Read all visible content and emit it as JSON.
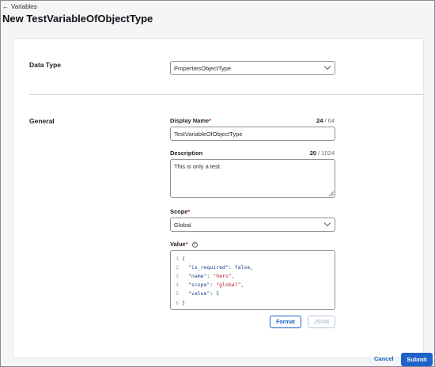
{
  "breadcrumb": {
    "arrow": "←",
    "label": "Variables"
  },
  "page_title": "New TestVariableOfObjectType",
  "sections": {
    "data_type": {
      "label": "Data Type",
      "selected": "PropertiesObjectType"
    },
    "general": {
      "label": "General"
    }
  },
  "fields": {
    "display_name": {
      "label": "Display Name",
      "required": "*",
      "value": "TestVariableOfObjectType",
      "count": "24",
      "max": "/ 64"
    },
    "description": {
      "label": "Description",
      "value": "This is only a test.",
      "count": "20",
      "max": "/ 1024"
    },
    "scope": {
      "label": "Scope",
      "required": "*",
      "selected": "Global"
    },
    "value": {
      "label": "Value",
      "required": "*",
      "info_icon": "i",
      "lines": [
        {
          "n": "1",
          "t": "{"
        },
        {
          "n": "2",
          "key": "\"is_required\"",
          "val": "false",
          "kind": "bool",
          "comma": ","
        },
        {
          "n": "3",
          "key": "\"name\"",
          "val": "\"hero\"",
          "kind": "str",
          "comma": ","
        },
        {
          "n": "4",
          "key": "\"scope\"",
          "val": "\"global\"",
          "kind": "str",
          "comma": ","
        },
        {
          "n": "5",
          "key": "\"value\"",
          "val": "5",
          "kind": "num",
          "comma": ""
        },
        {
          "n": "6",
          "t": "}"
        }
      ]
    }
  },
  "buttons": {
    "format": "Format",
    "json": "JSON",
    "cancel": "Cancel",
    "submit": "Submit"
  },
  "colors": {
    "primary": "#1d63c9",
    "required": "#c4232f"
  }
}
